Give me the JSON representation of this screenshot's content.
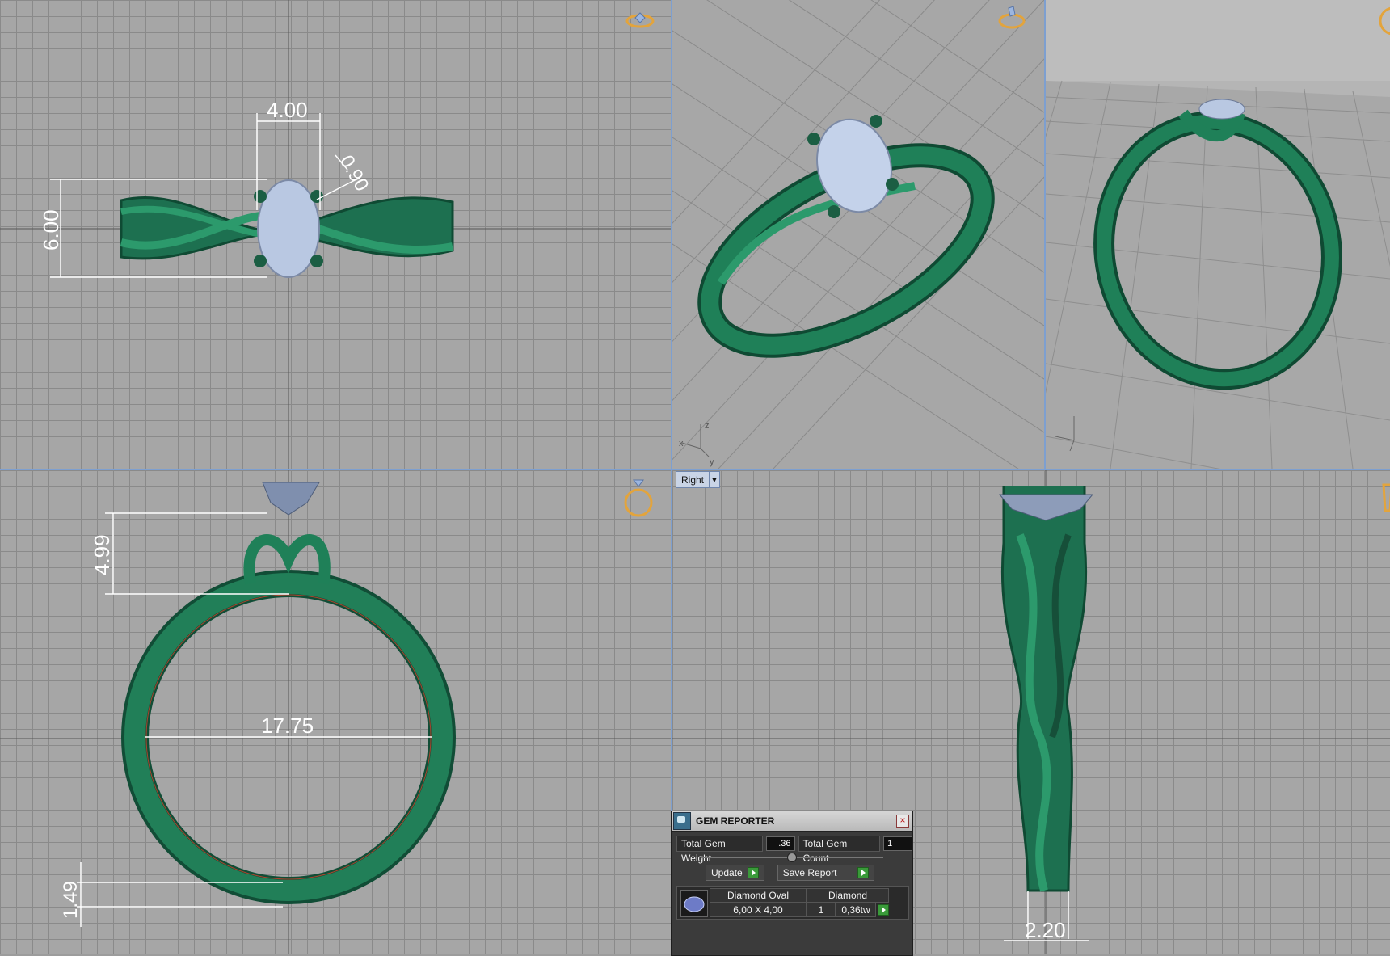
{
  "viewports": {
    "top": {
      "dims": {
        "width": "4.00",
        "height": "6.00",
        "prong": "0.90"
      }
    },
    "front": {
      "dims": {
        "top_height": "4.99",
        "inner_diameter": "17.75",
        "band_thickness": "1.49"
      }
    },
    "right": {
      "label": "Right",
      "dims": {
        "shank_width": "2.20"
      }
    },
    "axis": {
      "x": "x",
      "y": "y",
      "z": "z"
    }
  },
  "gem_reporter": {
    "title": "GEM REPORTER",
    "total_weight_label": "Total Gem Weight",
    "total_weight_value": ".36",
    "total_count_label": "Total Gem Count",
    "total_count_value": "1",
    "update_label": "Update",
    "save_report_label": "Save Report",
    "table": {
      "col_shape": "Diamond Oval",
      "col_material": "Diamond",
      "size": "6,00 X 4,00",
      "count": "1",
      "weight": "0,36tw"
    }
  },
  "colors": {
    "metal": "#1e7a55",
    "gem": "#b9c8e2",
    "dimension": "#ffffff",
    "gizmo": "#e3a43c",
    "separator": "#7d9fd0"
  }
}
